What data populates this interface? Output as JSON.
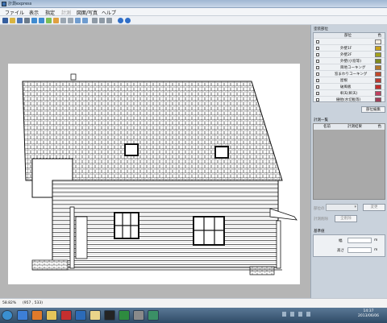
{
  "window": {
    "title": "計測express"
  },
  "menu": [
    {
      "label": "ファイル"
    },
    {
      "label": "表示"
    },
    {
      "label": "指定"
    },
    {
      "label": "計測"
    },
    {
      "label": "図面/写真"
    },
    {
      "label": "ヘルプ"
    }
  ],
  "toolbar": {
    "icons": [
      "pen-icon",
      "folder-icon",
      "save-icon",
      "print-icon",
      "zoom-in-icon",
      "zoom-out-icon",
      "rectangle-icon",
      "eraser-icon",
      "grid-icon",
      "line-icon",
      "undo-icon",
      "redo-icon",
      "align-icon",
      "distribute-icon",
      "settings-icon",
      "help-icon",
      "info-icon"
    ]
  },
  "panel": {
    "parts": {
      "title": "塗装部位",
      "columns": {
        "name": "部位",
        "color": "色"
      },
      "items": [
        {
          "label": "",
          "color": "#f4ede0"
        },
        {
          "label": "外壁1F",
          "color": "#c9a21b"
        },
        {
          "label": "外壁2F",
          "color": "#a1a11b"
        },
        {
          "label": "外壁(小窓等)",
          "color": "#7f8a1d"
        },
        {
          "label": "目地コーキング",
          "color": "#b2762a"
        },
        {
          "label": "窓まわりコーキング",
          "color": "#c4492a"
        },
        {
          "label": "屋根",
          "color": "#b93a32"
        },
        {
          "label": "破風板",
          "color": "#c32d2d"
        },
        {
          "label": "軒天(軒天)",
          "color": "#c04060"
        },
        {
          "label": "樋他(水切板等)",
          "color": "#a0405a"
        }
      ],
      "edit_button": "部位編集"
    },
    "measure": {
      "title": "計測一覧",
      "columns": {
        "name": "名前",
        "result": "計測結果",
        "color": "色"
      },
      "select_label": "部位の",
      "apply_button": "変更",
      "delete_label": "計測削除",
      "delete_all_button": "全削除"
    },
    "standard": {
      "title": "基準値",
      "width_label": "幅",
      "width_unit": "m",
      "height_label": "高さ",
      "height_unit": "m"
    }
  },
  "status": {
    "zoom": "58.82%",
    "coords": "(957 , 533)"
  },
  "taskbar": {
    "apps": [
      {
        "icon": "start-icon",
        "color": "#3a8fd0"
      },
      {
        "icon": "ie-icon",
        "color": "#3d7fd6"
      },
      {
        "icon": "firefox-icon",
        "color": "#e07a2a"
      },
      {
        "icon": "folder-icon",
        "color": "#e4c45a"
      },
      {
        "icon": "app-red-icon",
        "color": "#c62f2f"
      },
      {
        "icon": "app-blue-icon",
        "color": "#2c6bb8"
      },
      {
        "icon": "sticky-icon",
        "color": "#e9d58a"
      },
      {
        "icon": "app-dark-icon",
        "color": "#242424"
      },
      {
        "icon": "excel-icon",
        "color": "#2e8b3f"
      },
      {
        "icon": "app-gray-icon",
        "color": "#8a8a8a"
      },
      {
        "icon": "app-k-icon",
        "color": "#3b8f66"
      }
    ],
    "clock_time": "14:37",
    "clock_date": "2013/06/06"
  }
}
